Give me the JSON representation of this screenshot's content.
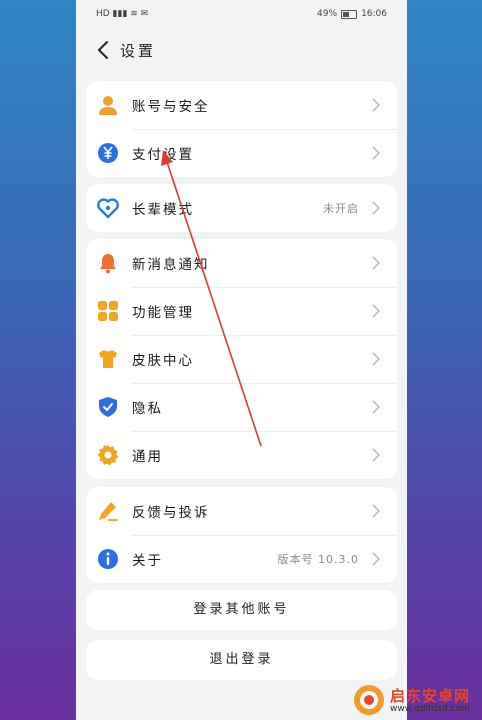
{
  "statusbar": {
    "left_icons": "HD ▮▮▮ ≋ ✉",
    "battery_text": "49%",
    "battery_level": 0.49,
    "time": "16:06"
  },
  "header": {
    "title": "设置",
    "back_icon": "back-arrow-icon"
  },
  "group1": [
    {
      "label": "账号与安全",
      "icon": "user-icon",
      "color": "#f0a030"
    },
    {
      "label": "支付设置",
      "icon": "yuan-icon",
      "color": "#2d6fe0"
    }
  ],
  "group2": [
    {
      "label": "长辈模式",
      "icon": "heart-icon",
      "color": "#2a7bd8",
      "value": "未开启"
    }
  ],
  "group3": [
    {
      "label": "新消息通知",
      "icon": "bell-icon",
      "color": "#f07030"
    },
    {
      "label": "功能管理",
      "icon": "grid-icon",
      "color": "#f3a520"
    },
    {
      "label": "皮肤中心",
      "icon": "tshirt-icon",
      "color": "#f3a520"
    },
    {
      "label": "隐私",
      "icon": "shield-icon",
      "color": "#2d6fe0"
    },
    {
      "label": "通用",
      "icon": "gear-icon",
      "color": "#f3a520"
    }
  ],
  "group4": [
    {
      "label": "反馈与投诉",
      "icon": "pencil-icon",
      "color": "#f3a520"
    },
    {
      "label": "关于",
      "icon": "info-icon",
      "color": "#2d6fe0",
      "value": "版本号 10.3.0"
    }
  ],
  "actions": {
    "switch_account": "登录其他账号",
    "logout": "退出登录"
  },
  "watermark": {
    "title": "启东安卓网",
    "url": "www.qdltdsd.com"
  }
}
